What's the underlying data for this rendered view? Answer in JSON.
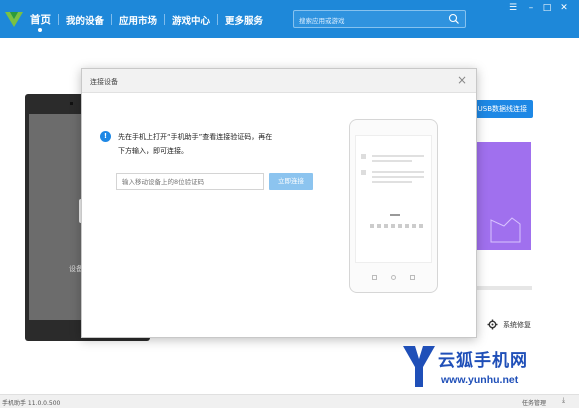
{
  "topbar": {
    "nav": [
      "首页",
      "我的设备",
      "应用市场",
      "游戏中心",
      "更多服务"
    ],
    "search_placeholder": "搜索应用或游戏",
    "accent": "#1e88d9"
  },
  "main": {
    "device_label": "设备",
    "usb_button": "USB数据线连接",
    "system_repair": "系统修复"
  },
  "dialog": {
    "title": "连接设备",
    "instruction_line1": "先在手机上打开“手机助手”查看连接验证码，再在",
    "instruction_line2": "下方输入，即可连接。",
    "input_placeholder": "输入移动设备上的8位验证码",
    "connect_button": "立即连接"
  },
  "statusbar": {
    "version": "手机助手 11.0.0.500",
    "task_manager": "任务管理"
  },
  "watermark": {
    "brand": "云狐手机网",
    "url": "www.yunhu.net"
  }
}
